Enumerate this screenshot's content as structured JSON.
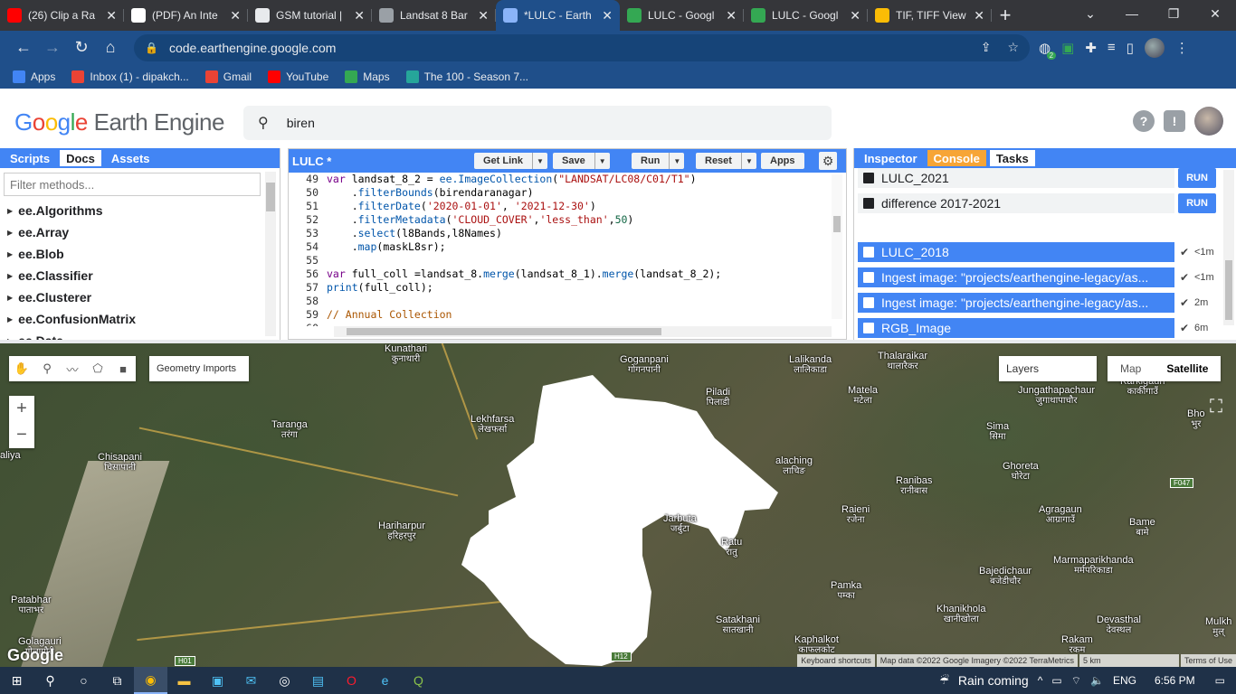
{
  "browser": {
    "tabs": [
      {
        "title": "(26) Clip a Ra",
        "icon": "youtube-icon",
        "color": "#ff0000"
      },
      {
        "title": "(PDF) An Inte",
        "icon": "academia-icon",
        "color": "#ffffff"
      },
      {
        "title": "GSM tutorial |",
        "icon": "globe-icon",
        "color": "#e8eaed"
      },
      {
        "title": "Landsat 8 Bar",
        "icon": "gis-icon",
        "color": "#9aa0a6"
      },
      {
        "title": "*LULC - Earth",
        "icon": "earth-engine-icon",
        "color": "#8ab4f8",
        "active": true
      },
      {
        "title": "LULC - Googl",
        "icon": "drive-icon",
        "color": "#34a853"
      },
      {
        "title": "LULC - Googl",
        "icon": "drive-icon",
        "color": "#34a853"
      },
      {
        "title": "TIF, TIFF View",
        "icon": "tif-icon",
        "color": "#fbbc05"
      }
    ],
    "url": "code.earthengine.google.com",
    "bookmarks": [
      {
        "label": "Apps",
        "icon": "apps-grid-icon",
        "color": "#4285f4"
      },
      {
        "label": "Inbox (1) - dipakch...",
        "icon": "gmail-icon",
        "color": "#ea4335"
      },
      {
        "label": "Gmail",
        "icon": "gmail-icon",
        "color": "#ea4335"
      },
      {
        "label": "YouTube",
        "icon": "youtube-icon",
        "color": "#ff0000"
      },
      {
        "label": "Maps",
        "icon": "maps-pin-icon",
        "color": "#34a853"
      },
      {
        "label": "The 100 - Season 7...",
        "icon": "fmovies-icon",
        "color": "#26a69a"
      }
    ],
    "ext_badge": "2"
  },
  "header": {
    "logo_google": [
      "G",
      "o",
      "o",
      "g",
      "l",
      "e"
    ],
    "logo_product": "Earth Engine",
    "search_value": "biren"
  },
  "left_panel": {
    "tabs": [
      "Scripts",
      "Docs",
      "Assets"
    ],
    "selected_tab": "Docs",
    "filter_placeholder": "Filter methods...",
    "items": [
      "ee.Algorithms",
      "ee.Array",
      "ee.Blob",
      "ee.Classifier",
      "ee.Clusterer",
      "ee.ConfusionMatrix",
      "ee.Date"
    ]
  },
  "editor": {
    "title": "LULC *",
    "buttons": {
      "get_link": "Get Link",
      "save": "Save",
      "run": "Run",
      "reset": "Reset",
      "apps": "Apps"
    },
    "lines": [
      {
        "n": "49",
        "html": "<span class=\"kw\">var</span> landsat_8_2 = <span class=\"fn\">ee.ImageCollection</span>(<span class=\"str\">\"LANDSAT/LC08/C01/T1\"</span>)"
      },
      {
        "n": "50",
        "html": "    .<span class=\"fn\">filterBounds</span>(birendaranagar)"
      },
      {
        "n": "51",
        "html": "    .<span class=\"fn\">filterDate</span>(<span class=\"str\">'2020-01-01'</span>, <span class=\"str\">'2021-12-30'</span>)"
      },
      {
        "n": "52",
        "html": "    .<span class=\"fn\">filterMetadata</span>(<span class=\"str\">'CLOUD_COVER'</span>,<span class=\"str\">'less_than'</span>,<span class=\"num\">50</span>)"
      },
      {
        "n": "53",
        "html": "    .<span class=\"fn\">select</span>(l8Bands,l8Names)"
      },
      {
        "n": "54",
        "html": "    .<span class=\"fn\">map</span>(maskL8sr);"
      },
      {
        "n": "55",
        "html": ""
      },
      {
        "n": "56",
        "html": "<span class=\"kw\">var</span> full_coll =landsat_8.<span class=\"fn\">merge</span>(landsat_8_1).<span class=\"fn\">merge</span>(landsat_8_2);"
      },
      {
        "n": "57",
        "html": "<span class=\"fn\">print</span>(full_coll);"
      },
      {
        "n": "58",
        "html": ""
      },
      {
        "n": "59",
        "html": "<span class=\"cm\">// Annual Collection</span>"
      },
      {
        "n": "60",
        "html": ""
      }
    ]
  },
  "right_panel": {
    "tabs": [
      "Inspector",
      "Console",
      "Tasks"
    ],
    "selected_tab": "Tasks",
    "pending": [
      {
        "name": "LULC_2021",
        "action": "RUN"
      },
      {
        "name": "difference 2017-2021",
        "action": "RUN"
      }
    ],
    "completed": [
      {
        "name": "LULC_2018",
        "time": "<1m",
        "icon": "image-icon"
      },
      {
        "name": "Ingest image: \"projects/earthengine-legacy/as...",
        "time": "<1m",
        "icon": "upload-icon"
      },
      {
        "name": "Ingest image: \"projects/earthengine-legacy/as...",
        "time": "2m",
        "icon": "upload-icon"
      },
      {
        "name": "RGB_Image",
        "time": "6m",
        "icon": "image-icon"
      }
    ]
  },
  "map": {
    "geometry_imports": "Geometry Imports",
    "layers": "Layers",
    "map_type": [
      "Map",
      "Satellite"
    ],
    "selected_map_type": "Satellite",
    "labels": [
      {
        "en": "Kunathari",
        "np": "कुनाथारी"
      },
      {
        "en": "Goganpani",
        "np": "गोगनपानी"
      },
      {
        "en": "Lalikanda",
        "np": "लालिकाडा"
      },
      {
        "en": "Thalaraikar",
        "np": "थालारैकर"
      },
      {
        "en": "Karkigaun",
        "np": "कार्कीगाउँ"
      },
      {
        "en": "Piladi",
        "np": "पिलाडी"
      },
      {
        "en": "Matela",
        "np": "मटेला"
      },
      {
        "en": "Jungathapachaur",
        "np": "जुगाथापाचौर"
      },
      {
        "en": "Bho",
        "np": "भुर"
      },
      {
        "en": "Taranga",
        "np": "तरंगा"
      },
      {
        "en": "Lekhfarsa",
        "np": "लेखफर्सा"
      },
      {
        "en": "Sima",
        "np": "सिमा"
      },
      {
        "en": "Chisapani",
        "np": "चिसापानी"
      },
      {
        "en": "aliya",
        "np": ""
      },
      {
        "en": "alaching",
        "np": "लाचिङ"
      },
      {
        "en": "Ghoreta",
        "np": "घोरेटा"
      },
      {
        "en": "Ranibas",
        "np": "रानीबास"
      },
      {
        "en": "Hariharpur",
        "np": "हरिहरपुर"
      },
      {
        "en": "Jarbuta",
        "np": "जर्बुटा"
      },
      {
        "en": "Raieni",
        "np": "रजेना"
      },
      {
        "en": "Agragaun",
        "np": "आग्रागाउँ"
      },
      {
        "en": "Bame",
        "np": "बामे"
      },
      {
        "en": "Ratu",
        "np": "रातु"
      },
      {
        "en": "Bajedichaur",
        "np": "बजेडीचौर"
      },
      {
        "en": "Marmaparikhanda",
        "np": "मर्मपरिकाडा"
      },
      {
        "en": "Patabhar",
        "np": "पाताभर"
      },
      {
        "en": "Pamka",
        "np": "पम्का"
      },
      {
        "en": "Khanikhola",
        "np": "खानीखोला"
      },
      {
        "en": "Satakhani",
        "np": "सातखानी"
      },
      {
        "en": "Devasthal",
        "np": "देवस्थल"
      },
      {
        "en": "Mulkh",
        "np": "मुल्"
      },
      {
        "en": "Golagauri",
        "np": "गोलागौरी"
      },
      {
        "en": "Kaphalkot",
        "np": "काफलकोट"
      },
      {
        "en": "Rakam",
        "np": "रकम"
      }
    ],
    "shields": [
      "H01",
      "H12",
      "F047"
    ],
    "attribution": {
      "shortcuts": "Keyboard shortcuts",
      "data": "Map data ©2022 Google Imagery ©2022 TerraMetrics",
      "scale": "5 km",
      "terms": "Terms of Use"
    },
    "google_logo": "Google"
  },
  "taskbar": {
    "weather": "Rain coming",
    "lang": "ENG",
    "time": "6:56 PM"
  }
}
